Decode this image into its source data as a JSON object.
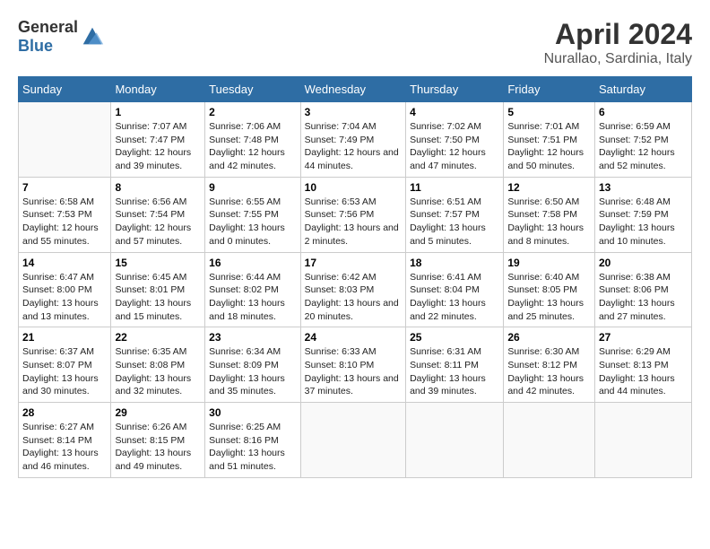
{
  "header": {
    "logo_general": "General",
    "logo_blue": "Blue",
    "title": "April 2024",
    "subtitle": "Nurallao, Sardinia, Italy"
  },
  "days_of_week": [
    "Sunday",
    "Monday",
    "Tuesday",
    "Wednesday",
    "Thursday",
    "Friday",
    "Saturday"
  ],
  "weeks": [
    [
      {
        "day": "",
        "sunrise": "",
        "sunset": "",
        "daylight": "",
        "empty": true
      },
      {
        "day": "1",
        "sunrise": "Sunrise: 7:07 AM",
        "sunset": "Sunset: 7:47 PM",
        "daylight": "Daylight: 12 hours and 39 minutes."
      },
      {
        "day": "2",
        "sunrise": "Sunrise: 7:06 AM",
        "sunset": "Sunset: 7:48 PM",
        "daylight": "Daylight: 12 hours and 42 minutes."
      },
      {
        "day": "3",
        "sunrise": "Sunrise: 7:04 AM",
        "sunset": "Sunset: 7:49 PM",
        "daylight": "Daylight: 12 hours and 44 minutes."
      },
      {
        "day": "4",
        "sunrise": "Sunrise: 7:02 AM",
        "sunset": "Sunset: 7:50 PM",
        "daylight": "Daylight: 12 hours and 47 minutes."
      },
      {
        "day": "5",
        "sunrise": "Sunrise: 7:01 AM",
        "sunset": "Sunset: 7:51 PM",
        "daylight": "Daylight: 12 hours and 50 minutes."
      },
      {
        "day": "6",
        "sunrise": "Sunrise: 6:59 AM",
        "sunset": "Sunset: 7:52 PM",
        "daylight": "Daylight: 12 hours and 52 minutes."
      }
    ],
    [
      {
        "day": "7",
        "sunrise": "Sunrise: 6:58 AM",
        "sunset": "Sunset: 7:53 PM",
        "daylight": "Daylight: 12 hours and 55 minutes."
      },
      {
        "day": "8",
        "sunrise": "Sunrise: 6:56 AM",
        "sunset": "Sunset: 7:54 PM",
        "daylight": "Daylight: 12 hours and 57 minutes."
      },
      {
        "day": "9",
        "sunrise": "Sunrise: 6:55 AM",
        "sunset": "Sunset: 7:55 PM",
        "daylight": "Daylight: 13 hours and 0 minutes."
      },
      {
        "day": "10",
        "sunrise": "Sunrise: 6:53 AM",
        "sunset": "Sunset: 7:56 PM",
        "daylight": "Daylight: 13 hours and 2 minutes."
      },
      {
        "day": "11",
        "sunrise": "Sunrise: 6:51 AM",
        "sunset": "Sunset: 7:57 PM",
        "daylight": "Daylight: 13 hours and 5 minutes."
      },
      {
        "day": "12",
        "sunrise": "Sunrise: 6:50 AM",
        "sunset": "Sunset: 7:58 PM",
        "daylight": "Daylight: 13 hours and 8 minutes."
      },
      {
        "day": "13",
        "sunrise": "Sunrise: 6:48 AM",
        "sunset": "Sunset: 7:59 PM",
        "daylight": "Daylight: 13 hours and 10 minutes."
      }
    ],
    [
      {
        "day": "14",
        "sunrise": "Sunrise: 6:47 AM",
        "sunset": "Sunset: 8:00 PM",
        "daylight": "Daylight: 13 hours and 13 minutes."
      },
      {
        "day": "15",
        "sunrise": "Sunrise: 6:45 AM",
        "sunset": "Sunset: 8:01 PM",
        "daylight": "Daylight: 13 hours and 15 minutes."
      },
      {
        "day": "16",
        "sunrise": "Sunrise: 6:44 AM",
        "sunset": "Sunset: 8:02 PM",
        "daylight": "Daylight: 13 hours and 18 minutes."
      },
      {
        "day": "17",
        "sunrise": "Sunrise: 6:42 AM",
        "sunset": "Sunset: 8:03 PM",
        "daylight": "Daylight: 13 hours and 20 minutes."
      },
      {
        "day": "18",
        "sunrise": "Sunrise: 6:41 AM",
        "sunset": "Sunset: 8:04 PM",
        "daylight": "Daylight: 13 hours and 22 minutes."
      },
      {
        "day": "19",
        "sunrise": "Sunrise: 6:40 AM",
        "sunset": "Sunset: 8:05 PM",
        "daylight": "Daylight: 13 hours and 25 minutes."
      },
      {
        "day": "20",
        "sunrise": "Sunrise: 6:38 AM",
        "sunset": "Sunset: 8:06 PM",
        "daylight": "Daylight: 13 hours and 27 minutes."
      }
    ],
    [
      {
        "day": "21",
        "sunrise": "Sunrise: 6:37 AM",
        "sunset": "Sunset: 8:07 PM",
        "daylight": "Daylight: 13 hours and 30 minutes."
      },
      {
        "day": "22",
        "sunrise": "Sunrise: 6:35 AM",
        "sunset": "Sunset: 8:08 PM",
        "daylight": "Daylight: 13 hours and 32 minutes."
      },
      {
        "day": "23",
        "sunrise": "Sunrise: 6:34 AM",
        "sunset": "Sunset: 8:09 PM",
        "daylight": "Daylight: 13 hours and 35 minutes."
      },
      {
        "day": "24",
        "sunrise": "Sunrise: 6:33 AM",
        "sunset": "Sunset: 8:10 PM",
        "daylight": "Daylight: 13 hours and 37 minutes."
      },
      {
        "day": "25",
        "sunrise": "Sunrise: 6:31 AM",
        "sunset": "Sunset: 8:11 PM",
        "daylight": "Daylight: 13 hours and 39 minutes."
      },
      {
        "day": "26",
        "sunrise": "Sunrise: 6:30 AM",
        "sunset": "Sunset: 8:12 PM",
        "daylight": "Daylight: 13 hours and 42 minutes."
      },
      {
        "day": "27",
        "sunrise": "Sunrise: 6:29 AM",
        "sunset": "Sunset: 8:13 PM",
        "daylight": "Daylight: 13 hours and 44 minutes."
      }
    ],
    [
      {
        "day": "28",
        "sunrise": "Sunrise: 6:27 AM",
        "sunset": "Sunset: 8:14 PM",
        "daylight": "Daylight: 13 hours and 46 minutes."
      },
      {
        "day": "29",
        "sunrise": "Sunrise: 6:26 AM",
        "sunset": "Sunset: 8:15 PM",
        "daylight": "Daylight: 13 hours and 49 minutes."
      },
      {
        "day": "30",
        "sunrise": "Sunrise: 6:25 AM",
        "sunset": "Sunset: 8:16 PM",
        "daylight": "Daylight: 13 hours and 51 minutes."
      },
      {
        "day": "",
        "sunrise": "",
        "sunset": "",
        "daylight": "",
        "empty": true
      },
      {
        "day": "",
        "sunrise": "",
        "sunset": "",
        "daylight": "",
        "empty": true
      },
      {
        "day": "",
        "sunrise": "",
        "sunset": "",
        "daylight": "",
        "empty": true
      },
      {
        "day": "",
        "sunrise": "",
        "sunset": "",
        "daylight": "",
        "empty": true
      }
    ]
  ]
}
